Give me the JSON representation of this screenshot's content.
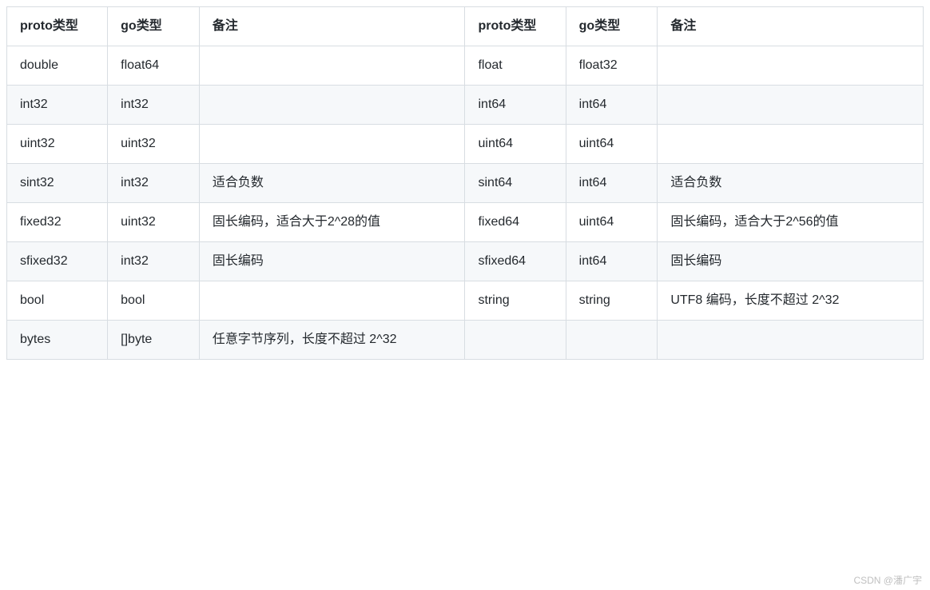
{
  "table": {
    "headers": {
      "proto1": "proto类型",
      "go1": "go类型",
      "note1": "备注",
      "proto2": "proto类型",
      "go2": "go类型",
      "note2": "备注"
    },
    "rows": [
      {
        "proto1": "double",
        "go1": "float64",
        "note1": "",
        "proto2": "float",
        "go2": "float32",
        "note2": ""
      },
      {
        "proto1": "int32",
        "go1": "int32",
        "note1": "",
        "proto2": "int64",
        "go2": "int64",
        "note2": ""
      },
      {
        "proto1": "uint32",
        "go1": "uint32",
        "note1": "",
        "proto2": "uint64",
        "go2": "uint64",
        "note2": ""
      },
      {
        "proto1": "sint32",
        "go1": "int32",
        "note1": "适合负数",
        "proto2": "sint64",
        "go2": "int64",
        "note2": "适合负数"
      },
      {
        "proto1": "fixed32",
        "go1": "uint32",
        "note1": "固长编码，适合大于2^28的值",
        "proto2": "fixed64",
        "go2": "uint64",
        "note2": "固长编码，适合大于2^56的值"
      },
      {
        "proto1": "sfixed32",
        "go1": "int32",
        "note1": "固长编码",
        "proto2": "sfixed64",
        "go2": "int64",
        "note2": "固长编码"
      },
      {
        "proto1": "bool",
        "go1": "bool",
        "note1": "",
        "proto2": "string",
        "go2": "string",
        "note2": "UTF8 编码，长度不超过 2^32"
      },
      {
        "proto1": "bytes",
        "go1": "[]byte",
        "note1": "任意字节序列，长度不超过 2^32",
        "proto2": "",
        "go2": "",
        "note2": ""
      }
    ]
  },
  "watermark": "CSDN @潘广宇"
}
